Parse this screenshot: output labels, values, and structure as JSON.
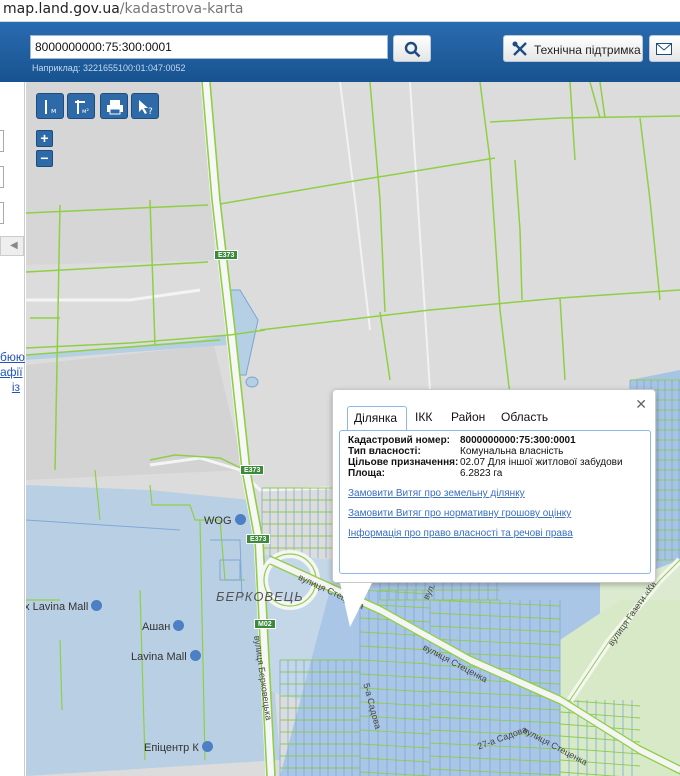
{
  "browser": {
    "host": "map.land.gov.ua",
    "path": "/kadastrova-karta"
  },
  "header": {
    "search_value": "8000000000:75:300:0001",
    "hint": "Наприклад: 3221655100:01:047:0052",
    "support_label": "Технічна підтримка"
  },
  "left_panel": {
    "links": [
      "бюю",
      "афії",
      "із"
    ]
  },
  "map": {
    "labels": {
      "berkovets": "БЕРКОВЕЦЬ",
      "wog": "WOG",
      "lavina_ex": "ex Lavina Mall",
      "ashan": "Ашан",
      "lavina": "Lavina Mall",
      "epicentr": "Епіцентр К"
    },
    "roads": {
      "e373_a": "E373",
      "e373_b": "E373",
      "e373_c": "E373",
      "m02": "M02"
    },
    "streets": {
      "berkovetska": "вулиця Берковецька",
      "stetsenka_1": "вулиця Стеценка",
      "stetsenka_2": "вулиця Стеценка",
      "stetsenka_3": "вулиця Стеценка",
      "sadova": "27-а Садова",
      "gazeta": "вулиця Газети «Ки",
      "sadova5": "5-а Садова",
      "sadova2": "вул. 7-а Садова"
    }
  },
  "popup": {
    "tabs": [
      "Ділянка",
      "ІКК",
      "Район",
      "Область"
    ],
    "rows": [
      {
        "k": "Кадастровий номер:",
        "v": "8000000000:75:300:0001"
      },
      {
        "k": "Тип власності:",
        "v": "Комунальна власність"
      },
      {
        "k": "Цільове призначення:",
        "v": "02.07 Для іншої житлової забудови"
      },
      {
        "k": "Площа:",
        "v": "6.2823 га"
      }
    ],
    "links": [
      "Замовити Витяг про земельну ділянку",
      "Замовити Витяг про нормативну грошову оцінку",
      "Інформація про право власності та речові права"
    ]
  }
}
